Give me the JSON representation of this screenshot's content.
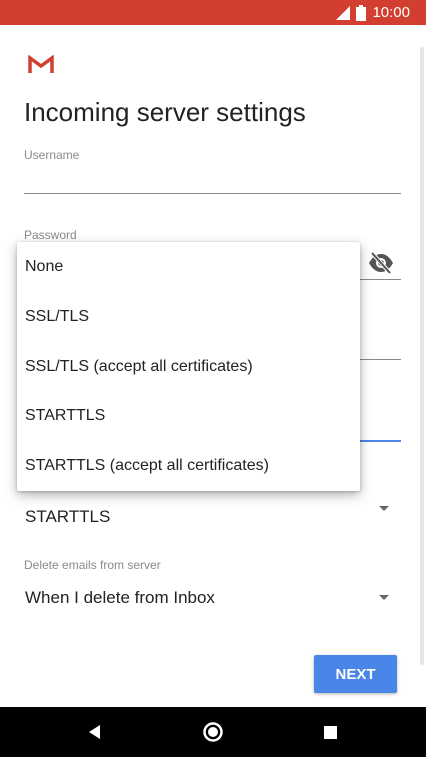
{
  "status_bar": {
    "time": "10:00",
    "background_color": "#d23f31",
    "icons": [
      "signal-icon",
      "battery-icon"
    ]
  },
  "app": {
    "logo_icon": "gmail-logo-icon",
    "title": "Incoming server settings"
  },
  "form": {
    "username": {
      "label": "Username",
      "value": ""
    },
    "password": {
      "label": "Password",
      "value": "",
      "toggle_icon": "visibility-off-icon"
    },
    "security_type": {
      "value": "STARTTLS"
    },
    "delete_emails": {
      "label": "Delete emails from server",
      "value": "When I delete from Inbox"
    }
  },
  "dropdown_menu": {
    "options": [
      "None",
      "SSL/TLS",
      "SSL/TLS (accept all certificates)",
      "STARTTLS",
      "STARTTLS (accept all certificates)"
    ]
  },
  "actions": {
    "next_label": "NEXT"
  },
  "colors": {
    "accent": "#4a86e8",
    "brand": "#d23f31"
  },
  "nav_bar": {
    "icons": [
      "back-icon",
      "home-icon",
      "recents-icon"
    ]
  }
}
